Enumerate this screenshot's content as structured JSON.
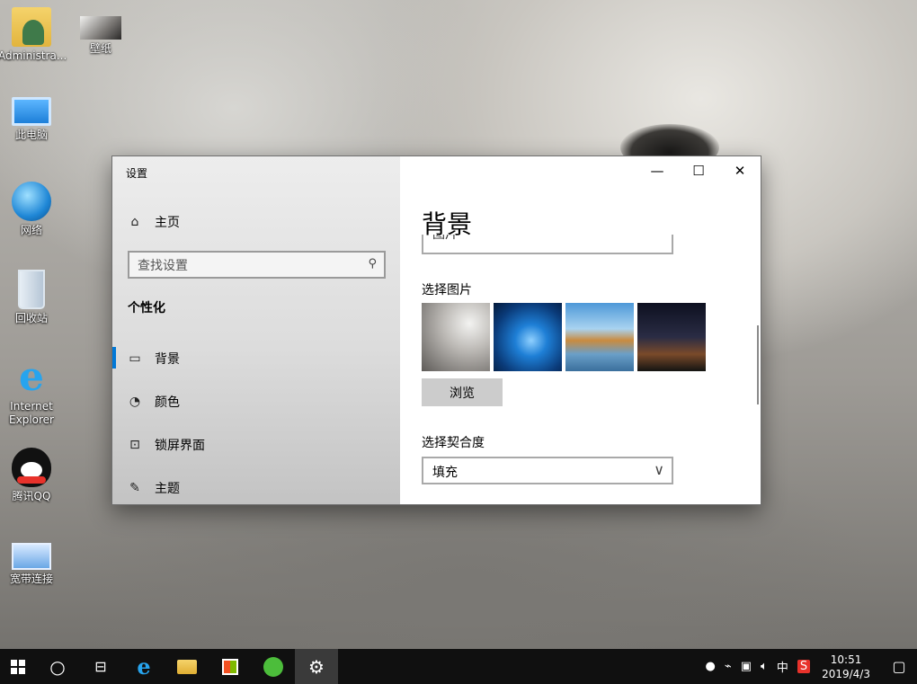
{
  "desktop": {
    "icons": [
      {
        "label": "Administra...",
        "icon": "user-folder-icon"
      },
      {
        "label": "壁纸",
        "icon": "wallpaper-thumbnail-icon"
      },
      {
        "label": "此电脑",
        "icon": "computer-icon"
      },
      {
        "label": "网络",
        "icon": "network-globe-icon"
      },
      {
        "label": "回收站",
        "icon": "recycle-bin-icon"
      },
      {
        "label": "Internet Explorer",
        "icon": "internet-explorer-icon"
      },
      {
        "label": "腾讯QQ",
        "icon": "qq-penguin-icon"
      },
      {
        "label": "宽带连接",
        "icon": "broadband-connection-icon"
      }
    ]
  },
  "window": {
    "title": "设置",
    "controls": {
      "minimize": "—",
      "maximize": "☐",
      "close": "✕"
    },
    "sidebar": {
      "home_label": "主页",
      "search_placeholder": "查找设置",
      "section_heading": "个性化",
      "items": [
        {
          "label": "背景",
          "icon": "picture-icon",
          "selected": true
        },
        {
          "label": "颜色",
          "icon": "palette-icon",
          "selected": false
        },
        {
          "label": "锁屏界面",
          "icon": "lock-screen-icon",
          "selected": false
        },
        {
          "label": "主题",
          "icon": "theme-brush-icon",
          "selected": false
        }
      ]
    },
    "content": {
      "title": "背景",
      "background_dropdown_value": "图片",
      "choose_picture_label": "选择图片",
      "browse_button": "浏览",
      "choose_fit_label": "选择契合度",
      "fit_value": "填充"
    }
  },
  "taskbar": {
    "clock_time": "10:51",
    "clock_date": "2019/4/3",
    "ime": "中",
    "accent_active": "#3a3a3a"
  }
}
